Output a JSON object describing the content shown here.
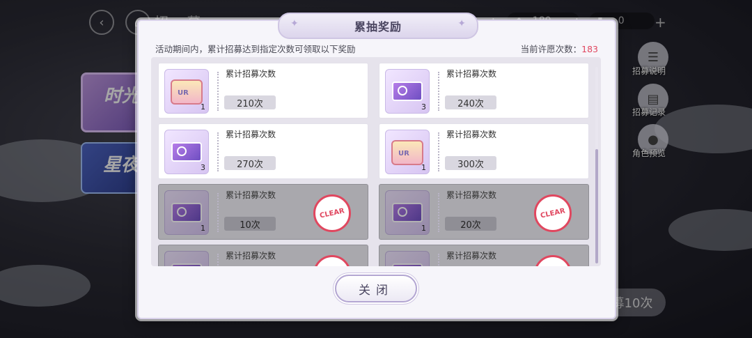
{
  "background": {
    "top_title": "招 募",
    "currency_a": "180",
    "currency_b": "0",
    "banner1_text": "时光",
    "banner2_text": "星夜",
    "side_buttons": [
      {
        "label": "招募说明",
        "icon": "document-icon"
      },
      {
        "label": "招募记录",
        "icon": "cards-icon"
      },
      {
        "label": "角色预览",
        "icon": "person-icon"
      }
    ],
    "bottom_button": "募10次"
  },
  "modal": {
    "title": "累抽奖励",
    "description": "活动期间内，累计招募达到指定次数可领取以下奖励",
    "wish_count_label": "当前许愿次数：",
    "wish_count_value": "183",
    "close_label": "关闭",
    "stamp_text": "CLEAR",
    "rewards": [
      {
        "label": "累计招募次数",
        "threshold": "210次",
        "qty": "1",
        "icon": "ur-chest-icon",
        "claimed": false
      },
      {
        "label": "累计招募次数",
        "threshold": "240次",
        "qty": "3",
        "icon": "time-ticket-icon",
        "claimed": false
      },
      {
        "label": "累计招募次数",
        "threshold": "270次",
        "qty": "3",
        "icon": "time-ticket-icon",
        "claimed": false
      },
      {
        "label": "累计招募次数",
        "threshold": "300次",
        "qty": "1",
        "icon": "ur-chest-icon",
        "claimed": false
      },
      {
        "label": "累计招募次数",
        "threshold": "10次",
        "qty": "1",
        "icon": "time-ticket-icon",
        "claimed": true
      },
      {
        "label": "累计招募次数",
        "threshold": "20次",
        "qty": "1",
        "icon": "time-ticket-icon",
        "claimed": true
      },
      {
        "label": "累计招募次数",
        "threshold": "",
        "qty": "",
        "icon": "time-ticket-icon",
        "claimed": true
      },
      {
        "label": "累计招募次数",
        "threshold": "",
        "qty": "",
        "icon": "time-ticket-icon",
        "claimed": true
      }
    ]
  }
}
